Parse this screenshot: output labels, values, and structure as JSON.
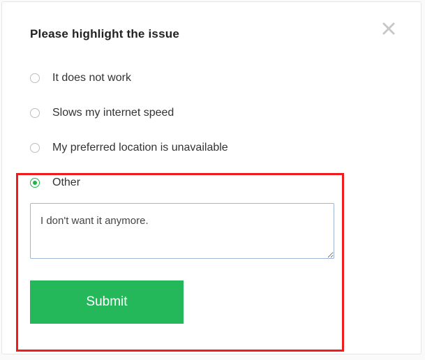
{
  "title": "Please highlight the issue",
  "options": [
    {
      "label": "It does not work",
      "selected": false
    },
    {
      "label": "Slows my internet speed",
      "selected": false
    },
    {
      "label": "My preferred location is unavailable",
      "selected": false
    },
    {
      "label": "Other",
      "selected": true
    }
  ],
  "other_text": "I don't want it anymore.",
  "submit_label": "Submit"
}
